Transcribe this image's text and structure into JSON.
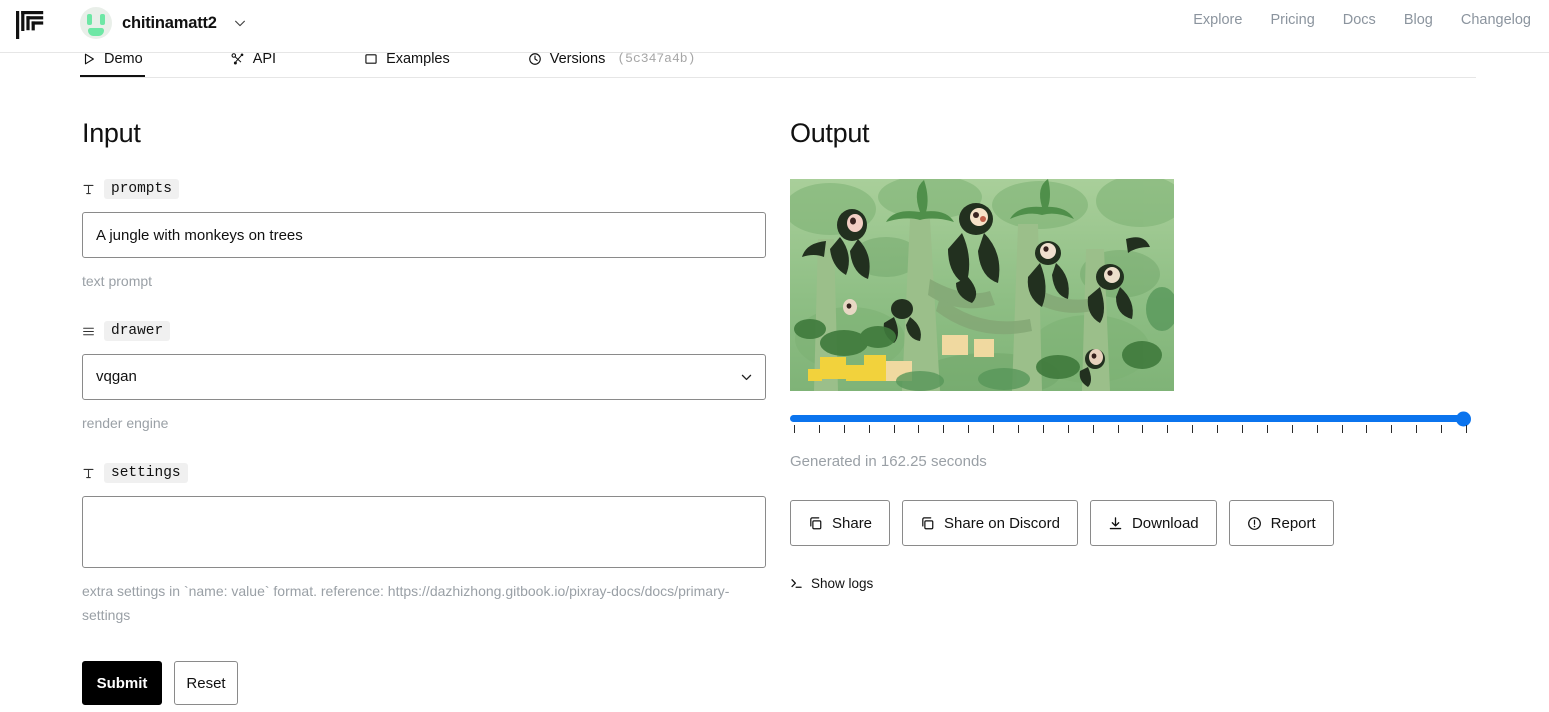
{
  "header": {
    "logo_icon": "replicate-logo-icon",
    "username": "chitinamatt2",
    "user_chevron_icon": "chevron-down-icon",
    "nav": [
      {
        "label": "Explore"
      },
      {
        "label": "Pricing"
      },
      {
        "label": "Docs"
      },
      {
        "label": "Blog"
      },
      {
        "label": "Changelog"
      }
    ]
  },
  "tabs": [
    {
      "label": "Demo",
      "icon": "play-icon",
      "active": true
    },
    {
      "label": "API",
      "icon": "api-node-icon",
      "active": false
    },
    {
      "label": "Examples",
      "icon": "image-frame-icon",
      "active": false
    },
    {
      "label": "Versions",
      "icon": "clock-icon",
      "active": false,
      "hash": "(5c347a4b)"
    }
  ],
  "input": {
    "heading": "Input",
    "fields": [
      {
        "name": "prompts",
        "icon": "text-type-icon",
        "type": "text",
        "value": "A jungle with monkeys on trees",
        "placeholder": "",
        "helper": "text prompt"
      },
      {
        "name": "drawer",
        "icon": "list-icon",
        "type": "select",
        "value": "vqgan",
        "options": [
          "vqgan"
        ],
        "chevron_icon": "chevron-down-icon",
        "helper": "render engine"
      },
      {
        "name": "settings",
        "icon": "text-type-icon",
        "type": "textarea",
        "value": "",
        "placeholder": "",
        "helper": "extra settings in `name: value` format. reference: https://dazhizhong.gitbook.io/pixray-docs/docs/primary-settings"
      }
    ],
    "submit_label": "Submit",
    "reset_label": "Reset"
  },
  "output": {
    "heading": "Output",
    "image_alt": "generated jungle with monkeys on trees",
    "slider": {
      "value": 100,
      "min": 0,
      "max": 100,
      "tick_count": 28,
      "accent_color": "#0b74ee"
    },
    "generated_text": "Generated in 162.25 seconds",
    "actions": [
      {
        "label": "Share",
        "icon": "copy-icon"
      },
      {
        "label": "Share on Discord",
        "icon": "copy-icon"
      },
      {
        "label": "Download",
        "icon": "download-icon"
      },
      {
        "label": "Report",
        "icon": "alert-circle-icon"
      }
    ],
    "show_logs": {
      "label": "Show logs",
      "icon": "terminal-icon"
    }
  }
}
